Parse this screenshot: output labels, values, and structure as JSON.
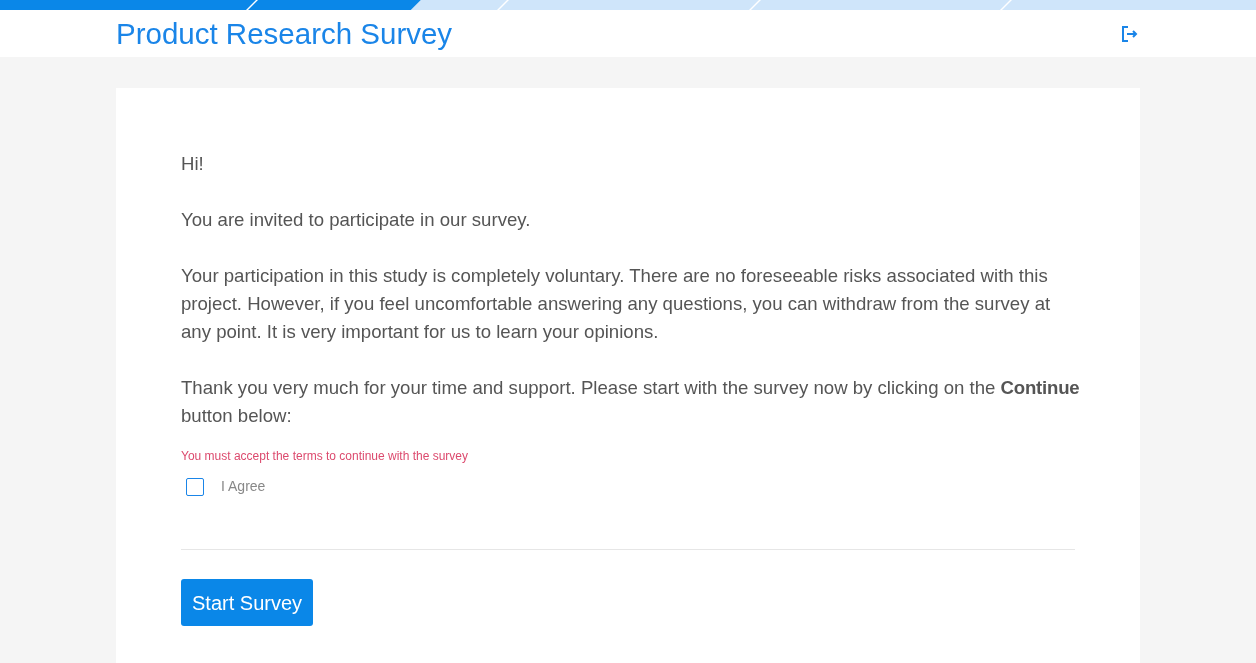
{
  "progress": {
    "level": 0.335
  },
  "header": {
    "title": "Product Research Survey"
  },
  "intro": {
    "paragraphs": [
      "Hi!",
      "You are invited to participate in our survey.",
      "Your participation in this study is completely voluntary. There are no foreseeable risks associated with this project. However, if you feel uncomfortable answering any questions, you can withdraw from the survey at any point. It is very important for us to learn your opinions.",
      "Thank you very much for your time and support. Please start with the survey now by clicking on the **Continue** button below:"
    ]
  },
  "consent": {
    "error": "You must accept the terms to continue with the survey",
    "label": "I Agree",
    "checked": false
  },
  "start_button": {
    "label": "Start Survey"
  }
}
